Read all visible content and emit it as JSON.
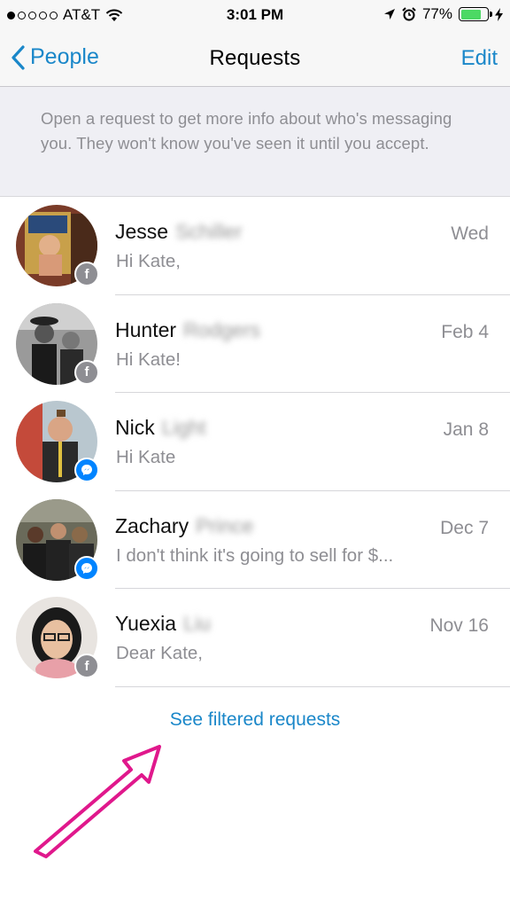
{
  "status_bar": {
    "carrier": "AT&T",
    "signal_bars_filled": 1,
    "signal_bars_total": 5,
    "time": "3:01 PM",
    "battery_percent": "77%",
    "battery_level": 0.77,
    "icons": [
      "wifi-icon",
      "location-arrow-icon",
      "alarm-clock-icon",
      "charging-bolt-icon"
    ]
  },
  "nav": {
    "back_label": "People",
    "title": "Requests",
    "edit_label": "Edit"
  },
  "info_banner": {
    "text": "Open a request to get more info about who's messaging you. They won't know you've seen it until you accept."
  },
  "requests": [
    {
      "first_name": "Jesse",
      "last_name_blurred": "Schiller",
      "date": "Wed",
      "preview": "Hi Kate,",
      "source": "facebook"
    },
    {
      "first_name": "Hunter",
      "last_name_blurred": "Rodgers",
      "date": "Feb 4",
      "preview": "Hi Kate!",
      "source": "facebook"
    },
    {
      "first_name": "Nick",
      "last_name_blurred": "Light",
      "date": "Jan 8",
      "preview": "Hi Kate",
      "source": "messenger"
    },
    {
      "first_name": "Zachary",
      "last_name_blurred": "Prince",
      "date": "Dec 7",
      "preview": "I don't think it's going to sell for $...",
      "source": "messenger"
    },
    {
      "first_name": "Yuexia",
      "last_name_blurred": "Liu",
      "date": "Nov 16",
      "preview": "Dear Kate,",
      "source": "facebook"
    }
  ],
  "footer": {
    "see_filtered_label": "See filtered requests"
  },
  "colors": {
    "accent": "#1a87c9",
    "annotation": "#e0188c",
    "messenger": "#0084ff",
    "battery": "#4cd964"
  }
}
